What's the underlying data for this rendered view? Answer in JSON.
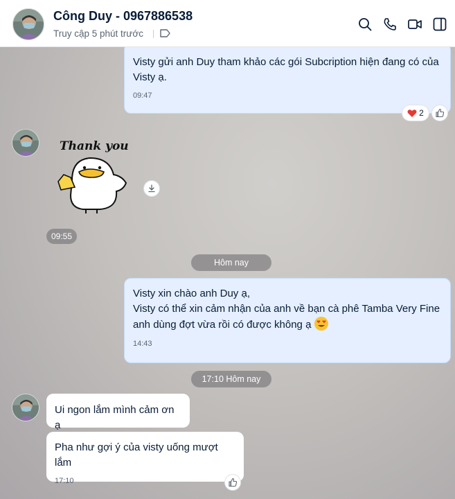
{
  "header": {
    "name": "Công Duy - 0967886538",
    "status": "Truy cập 5 phút trước",
    "icons": [
      "search-icon",
      "phone-icon",
      "video-call-icon",
      "sidebar-toggle-icon",
      "tag-icon"
    ]
  },
  "messages": {
    "m1": {
      "text": "Visty gửi anh Duy tham khảo các gói Subcription hiện đang có của Visty ạ.",
      "time": "09:47",
      "reaction_count": "2"
    },
    "sticker": {
      "text": "Thank you",
      "time": "09:55"
    },
    "date_divider": "Hôm nay",
    "m2": {
      "line1": "Visty xin chào anh Duy ạ,",
      "line2": "Visty có thể xin cảm nhận của anh về bạn cà phê Tamba Very Fine anh dùng đợt vừa rồi có được không ạ",
      "time": "14:43"
    },
    "time_divider": "17:10 Hôm nay",
    "m3": {
      "text": "Ui ngon lắm mình cảm ơn ạ"
    },
    "m4": {
      "text": "Pha như gợi ý của visty uống mượt lắm",
      "time": "17:10"
    }
  },
  "colors": {
    "mine_bubble": "#e5efff",
    "theirs_bubble": "#ffffff",
    "header_bg": "#ffffff",
    "accent": "#0068ff"
  }
}
